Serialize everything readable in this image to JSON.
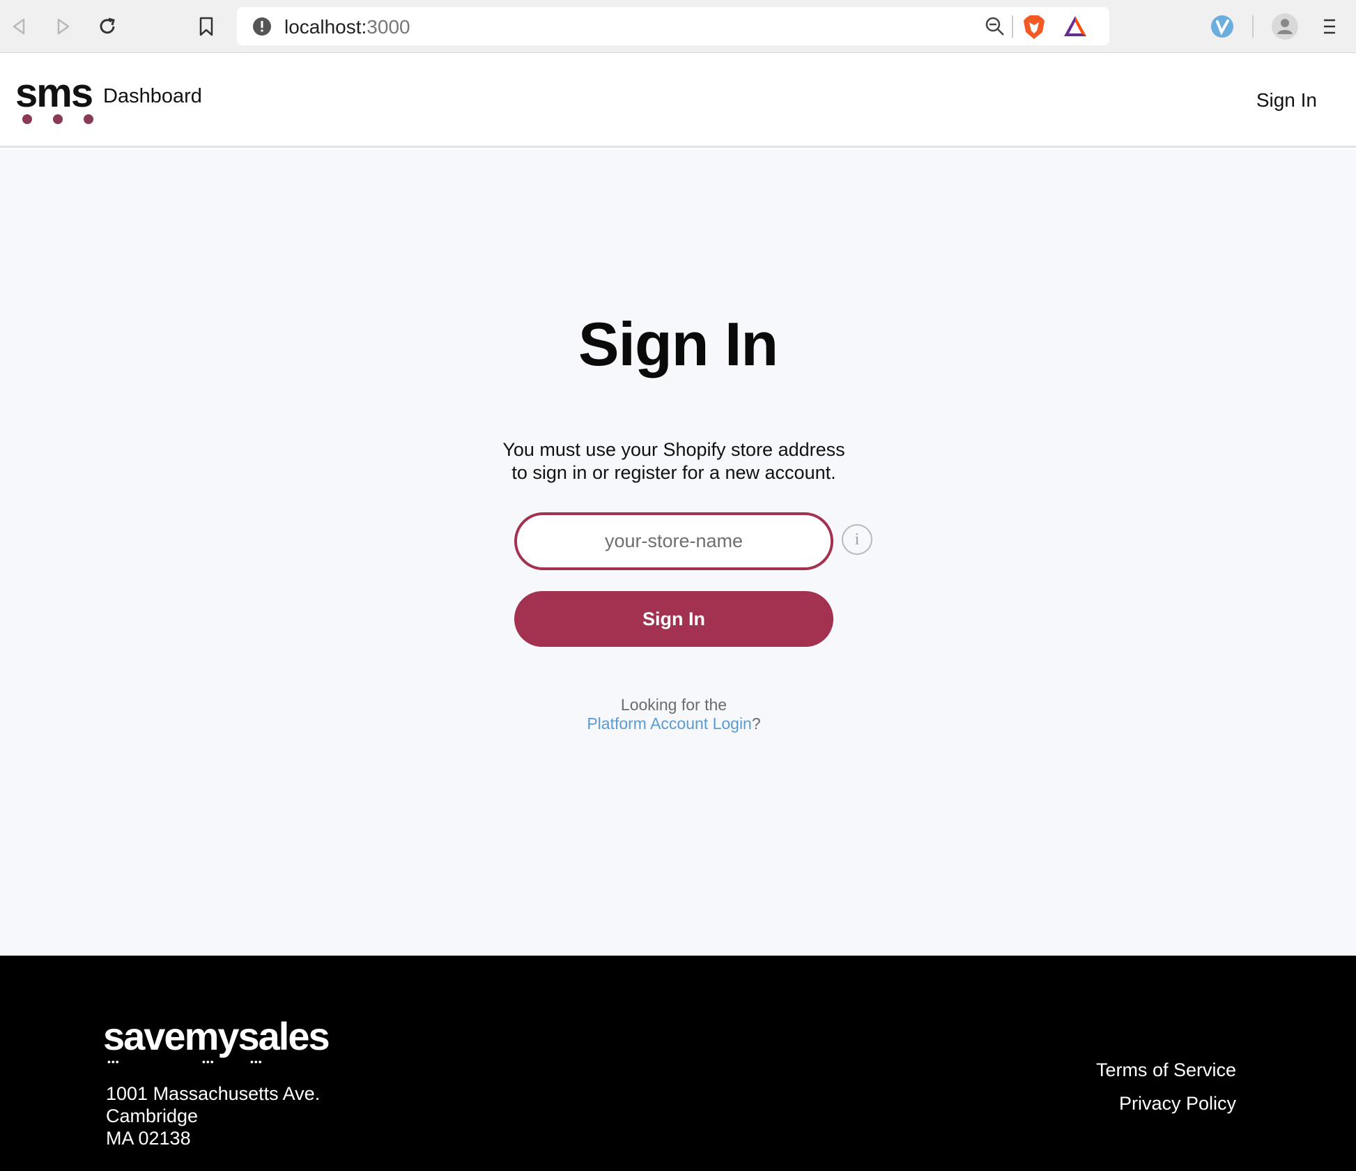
{
  "browser": {
    "url_host": "localhost:",
    "url_port": "3000"
  },
  "header": {
    "logo_text": "sms",
    "brand": "Dashboard",
    "signin_link": "Sign In"
  },
  "main": {
    "title": "Sign In",
    "instruction_line1": "You must use your Shopify store address",
    "instruction_line2": "to sign in or register for a new account.",
    "store_placeholder": "your-store-name",
    "info_symbol": "i",
    "signin_button": "Sign In",
    "platform_prefix": "Looking for the",
    "platform_link": "Platform Account Login",
    "platform_suffix": "?"
  },
  "footer": {
    "logo": "savemysales",
    "address_line1": "1001 Massachusetts Ave.",
    "address_line2": "Cambridge",
    "address_line3": "MA 02138",
    "terms": "Terms of Service",
    "privacy": "Privacy Policy"
  },
  "colors": {
    "brand_accent": "#a33150",
    "main_bg": "#f7f8fc",
    "link": "#5b9bd4",
    "footer_bg": "#000000"
  }
}
